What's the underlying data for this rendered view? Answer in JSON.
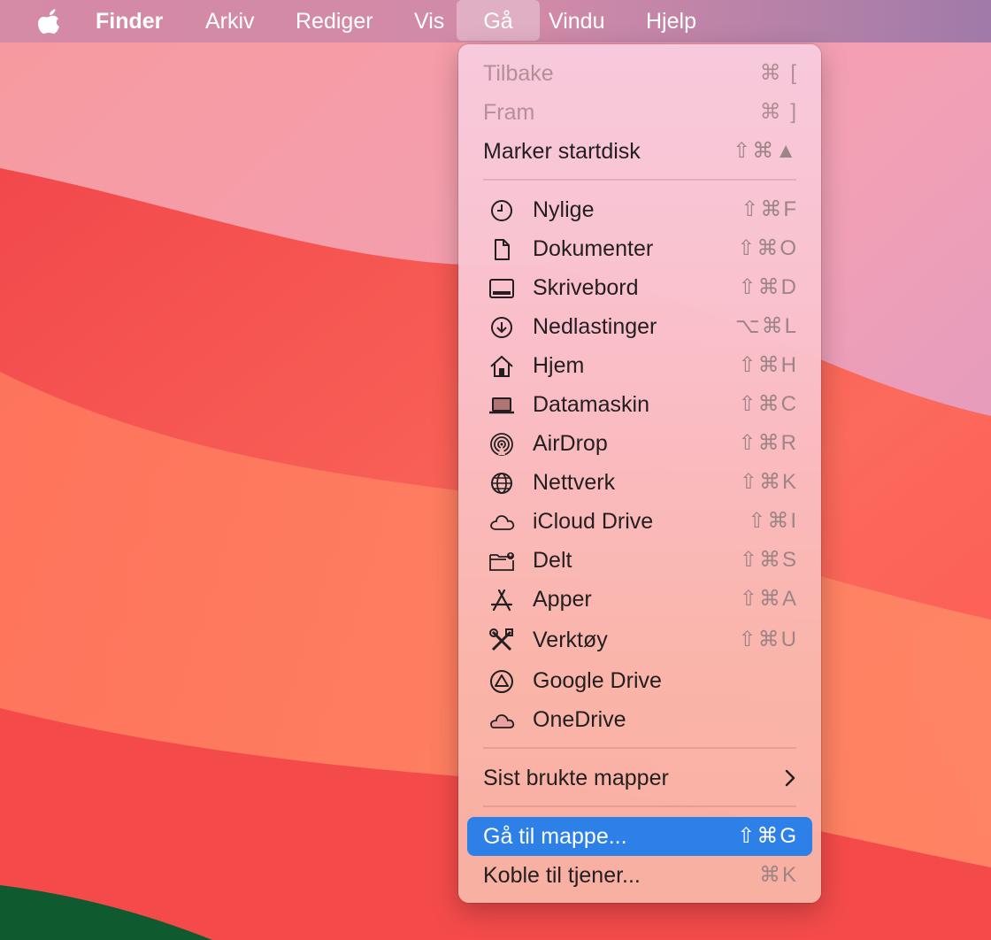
{
  "menubar": {
    "apple_icon": "apple-logo-icon",
    "items": [
      "Finder",
      "Arkiv",
      "Rediger",
      "Vis",
      "Gå",
      "Vindu",
      "Hjelp"
    ],
    "active": "Gå"
  },
  "menu": {
    "nav": [
      {
        "label": "Tilbake",
        "shortcut": "⌘ [",
        "disabled": true
      },
      {
        "label": "Fram",
        "shortcut": "⌘ ]",
        "disabled": true
      },
      {
        "label": "Marker startdisk",
        "shortcut": "⇧⌘▲"
      }
    ],
    "places": [
      {
        "label": "Nylige",
        "shortcut": "⇧⌘F",
        "icon": "clock-icon"
      },
      {
        "label": "Dokumenter",
        "shortcut": "⇧⌘O",
        "icon": "document-icon"
      },
      {
        "label": "Skrivebord",
        "shortcut": "⇧⌘D",
        "icon": "desktop-icon"
      },
      {
        "label": "Nedlastinger",
        "shortcut": "⌥⌘L",
        "icon": "download-icon"
      },
      {
        "label": "Hjem",
        "shortcut": "⇧⌘H",
        "icon": "home-icon"
      },
      {
        "label": "Datamaskin",
        "shortcut": "⇧⌘C",
        "icon": "laptop-icon"
      },
      {
        "label": "AirDrop",
        "shortcut": "⇧⌘R",
        "icon": "airdrop-icon"
      },
      {
        "label": "Nettverk",
        "shortcut": "⇧⌘K",
        "icon": "globe-icon"
      },
      {
        "label": "iCloud Drive",
        "shortcut": "⇧⌘I",
        "icon": "cloud-icon"
      },
      {
        "label": "Delt",
        "shortcut": "⇧⌘S",
        "icon": "shared-folder-icon"
      },
      {
        "label": "Apper",
        "shortcut": "⇧⌘A",
        "icon": "apps-icon"
      },
      {
        "label": "Verktøy",
        "shortcut": "⇧⌘U",
        "icon": "utilities-icon"
      },
      {
        "label": "Google Drive",
        "shortcut": "",
        "icon": "google-drive-icon"
      },
      {
        "label": "OneDrive",
        "shortcut": "",
        "icon": "onedrive-cloud-icon"
      }
    ],
    "recent_folders": {
      "label": "Sist brukte mapper",
      "icon": "chevron-right-icon"
    },
    "goto_folder": {
      "label": "Gå til mappe...",
      "shortcut": "⇧⌘G"
    },
    "connect_server": {
      "label": "Koble til tjener...",
      "shortcut": "⌘K"
    },
    "highlight_color": "#2c80e8"
  }
}
